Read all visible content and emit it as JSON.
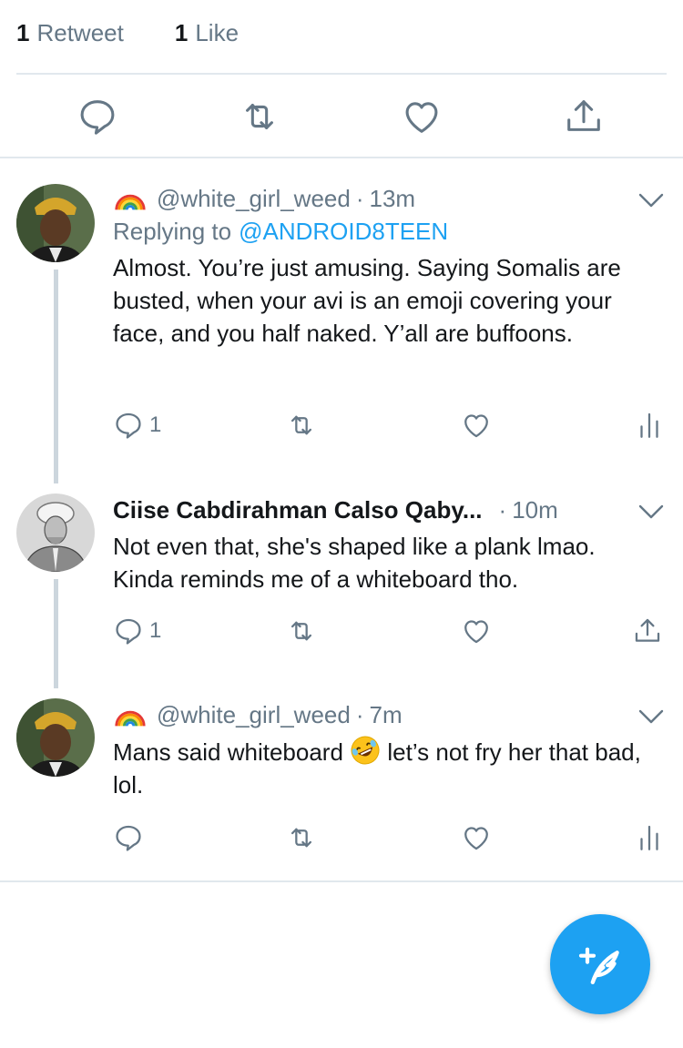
{
  "stats": {
    "retweets": {
      "count": "1",
      "label": "Retweet"
    },
    "likes": {
      "count": "1",
      "label": "Like"
    }
  },
  "colors": {
    "accent": "#1da1f2",
    "muted": "#657786",
    "divider": "#e1e8ed",
    "thread": "#ccd6dd"
  },
  "replies": [
    {
      "handle": "@white_girl_weed",
      "name_icon": "rainbow-emoji",
      "time": "13m",
      "replying_prefix": "Replying to",
      "replying_to": "@ANDROID8TEEN",
      "text": "Almost. You’re just amusing. Saying Somalis are busted, when your avi is an emoji covering your face, and you half naked. Y’all are buffoons.",
      "reply_count": "1",
      "last_action_icon": "analytics-icon"
    },
    {
      "name": "Ciise Cabdirahman Calso Qaby...",
      "time": "10m",
      "text": "Not even that, she's shaped like a plank lmao. Kinda reminds me of a whiteboard tho.",
      "reply_count": "1",
      "last_action_icon": "share-icon"
    },
    {
      "handle": "@white_girl_weed",
      "name_icon": "rainbow-emoji",
      "time": "7m",
      "text_before": "Mans said whiteboard",
      "text_emoji": "rolling-on-floor-laughing-emoji",
      "text_after": "let’s not fry her that bad, lol.",
      "last_action_icon": "analytics-icon"
    }
  ],
  "sep": "·"
}
